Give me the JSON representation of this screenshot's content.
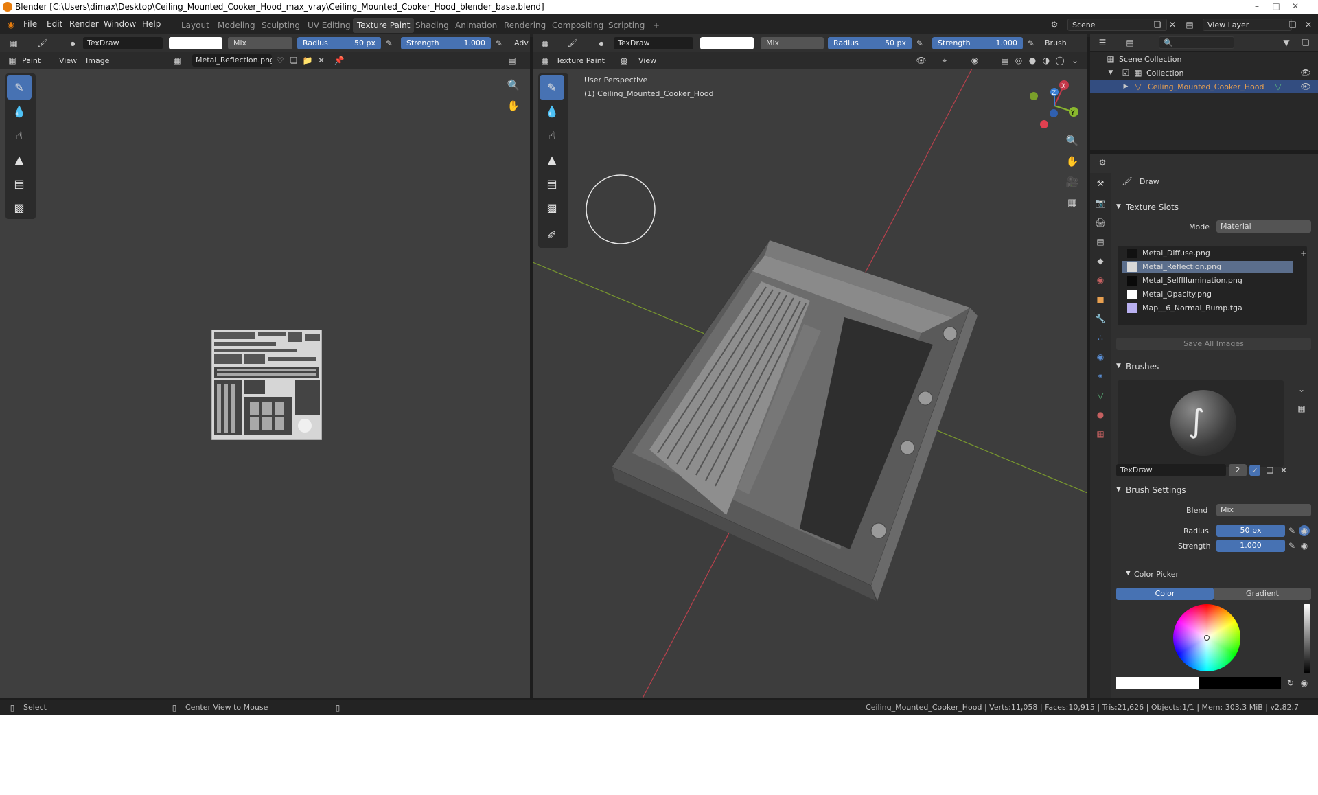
{
  "window": {
    "title": "Blender [C:\\Users\\dimax\\Desktop\\Ceiling_Mounted_Cooker_Hood_max_vray\\Ceiling_Mounted_Cooker_Hood_blender_base.blend]"
  },
  "menu": [
    "File",
    "Edit",
    "Render",
    "Window",
    "Help"
  ],
  "workspaces": [
    "Layout",
    "Modeling",
    "Sculpting",
    "UV Editing",
    "Texture Paint",
    "Shading",
    "Animation",
    "Rendering",
    "Compositing",
    "Scripting",
    "+"
  ],
  "active_workspace": "Texture Paint",
  "scene": {
    "name": "Scene",
    "view_layer": "View Layer"
  },
  "image_editor": {
    "brush_name": "TexDraw",
    "blend": "Mix",
    "radius_label": "Radius",
    "radius_value": "50 px",
    "strength_label": "Strength",
    "strength_value": "1.000",
    "overflow": "Adv",
    "mode": "Paint",
    "view_menu": "View",
    "image_menu": "Image",
    "image_name": "Metal_Reflection.png"
  },
  "viewport": {
    "brush_name": "TexDraw",
    "blend": "Mix",
    "radius_label": "Radius",
    "radius_value": "50 px",
    "strength_label": "Strength",
    "strength_value": "1.000",
    "brush_menu": "Brush",
    "mode": "Texture Paint",
    "view_menu": "View",
    "overlay_line1": "User Perspective",
    "overlay_line2": "(1) Ceiling_Mounted_Cooker_Hood",
    "gizmo": {
      "x": "X",
      "y": "Y",
      "z": "Z"
    }
  },
  "outliner": {
    "root": "Scene Collection",
    "collection": "Collection",
    "object": "Ceiling_Mounted_Cooker_Hood"
  },
  "properties": {
    "tool_name": "Draw",
    "texture_slots": {
      "header": "Texture Slots",
      "mode_label": "Mode",
      "mode_value": "Material",
      "slots": [
        {
          "name": "Metal_Diffuse.png",
          "color": "#111111",
          "selected": false
        },
        {
          "name": "Metal_Reflection.png",
          "color": "#d8d8d8",
          "selected": true
        },
        {
          "name": "Metal_SelfIllumination.png",
          "color": "#0a0a0a",
          "selected": false
        },
        {
          "name": "Metal_Opacity.png",
          "color": "#ffffff",
          "selected": false
        },
        {
          "name": "Map__6_Normal_Bump.tga",
          "color": "#b9b0f0",
          "selected": false
        }
      ],
      "save_button": "Save All Images"
    },
    "brushes": {
      "header": "Brushes",
      "brush_name": "TexDraw",
      "users": "2"
    },
    "brush_settings": {
      "header": "Brush Settings",
      "blend_label": "Blend",
      "blend_value": "Mix",
      "radius_label": "Radius",
      "radius_value": "50 px",
      "strength_label": "Strength",
      "strength_value": "1.000"
    },
    "color_picker": {
      "header": "Color Picker",
      "tab_color": "Color",
      "tab_gradient": "Gradient"
    }
  },
  "statusbar": {
    "select": "Select",
    "center_view": "Center View to Mouse",
    "stats": "Ceiling_Mounted_Cooker_Hood | Verts:11,058 | Faces:10,915 | Tris:21,626 | Objects:1/1 | Mem: 303.3 MiB | v2.82.7"
  },
  "colors": {
    "accent": "#4772b3",
    "orange_object": "#e8a050",
    "x_axis": "#c4384a",
    "y_axis": "#8ab82e",
    "z_axis": "#3a7fd6"
  }
}
